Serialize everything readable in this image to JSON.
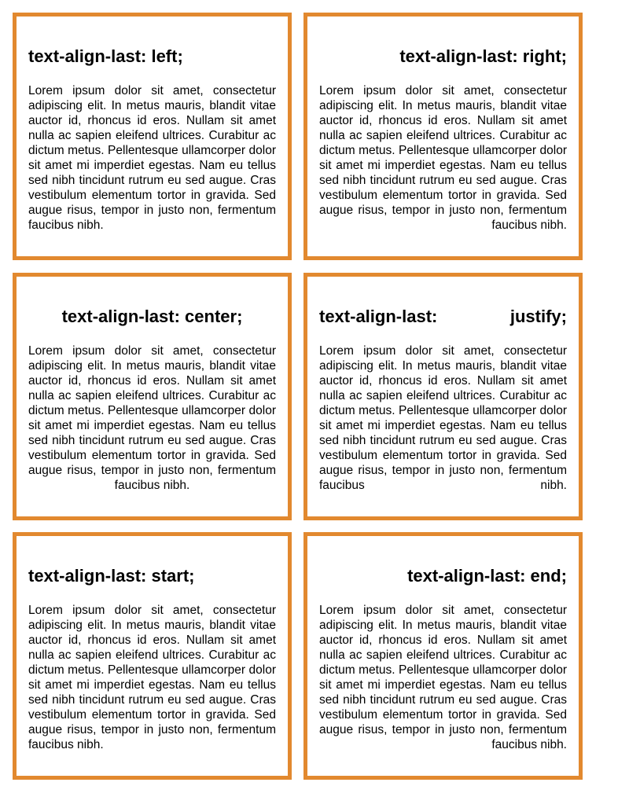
{
  "accent_color": "#e2892f",
  "boxes": [
    {
      "heading": "text-align-last: left;"
    },
    {
      "heading": "text-align-last: right;"
    },
    {
      "heading": "text-align-last: center;"
    },
    {
      "heading": "text-align-last: justify;"
    },
    {
      "heading": "text-align-last: start;"
    },
    {
      "heading": "text-align-last: end;"
    }
  ],
  "body_text": "Lorem ipsum dolor sit amet, consectetur adipiscing elit. In metus mauris, blandit vitae auctor id, rhoncus id eros. Nullam sit amet nulla ac sapien eleifend ultrices. Curabitur ac dictum metus. Pellentesque ullamcorper dolor sit amet mi imperdiet egestas. Nam eu tellus sed nibh tincidunt rutrum eu sed augue. Cras vestibulum elementum tortor in gravida. Sed augue risus, tempor in justo non, fermentum faucibus nibh."
}
